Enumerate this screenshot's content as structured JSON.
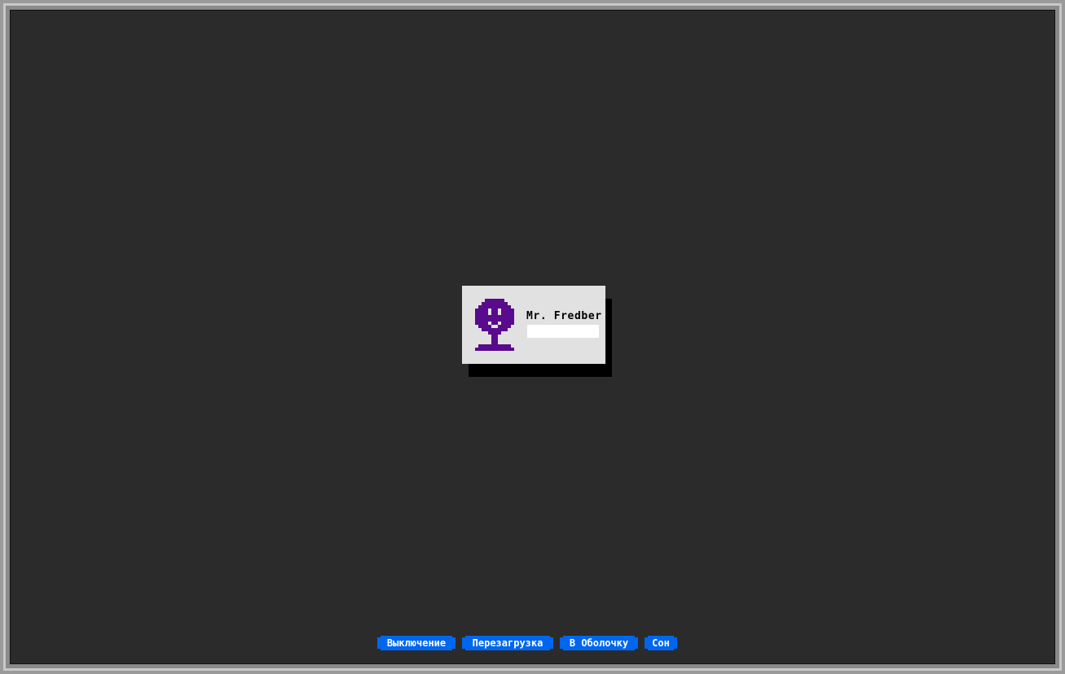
{
  "login": {
    "username": "Mr. Fredber",
    "password_value": "",
    "avatar_icon": "user-avatar-icon",
    "avatar_color": "#5a0a8c"
  },
  "power_buttons": {
    "shutdown_label": "Выключение",
    "reboot_label": "Перезагрузка",
    "shell_label": "В Оболочку",
    "sleep_label": "Сон"
  },
  "colors": {
    "background": "#2b2b2b",
    "card": "#e1e1e1",
    "button": "#0066ee",
    "button_text": "#ffffff"
  }
}
